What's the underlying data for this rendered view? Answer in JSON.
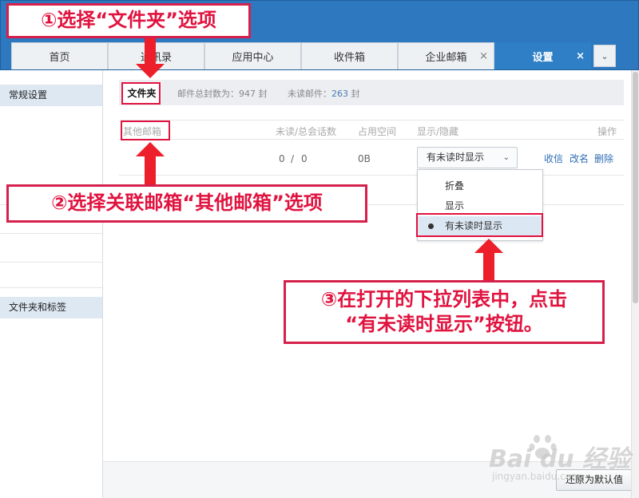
{
  "tabs": [
    {
      "label": "首页",
      "closable": false,
      "active": false
    },
    {
      "label": "通讯录",
      "closable": false,
      "active": false
    },
    {
      "label": "应用中心",
      "closable": false,
      "active": false
    },
    {
      "label": "收件箱",
      "closable": false,
      "active": false
    },
    {
      "label": "企业邮箱",
      "closable": true,
      "active": false
    },
    {
      "label": "设置",
      "closable": true,
      "active": true
    }
  ],
  "close_glyph": "×",
  "sidebar": {
    "items": [
      {
        "label": "常规设置"
      },
      {
        "label": "文件夹和标签"
      }
    ]
  },
  "infobar": {
    "folder_tab": "文件夹",
    "total_label": "邮件总封数为：",
    "total_value": "947",
    "total_unit": " 封",
    "unread_label": "未读邮件：",
    "unread_value": "263",
    "unread_unit": " 封"
  },
  "table": {
    "headers": {
      "name": "其他邮箱",
      "unread": "未读/总会话数",
      "space": "占用空间",
      "display": "显示/隐藏",
      "ops": "操作"
    },
    "row": {
      "unread": "0",
      "sep": "/",
      "total": "0",
      "space": "0B",
      "display_value": "有未读时显示",
      "ops": [
        "收信",
        "改名",
        "删除"
      ]
    }
  },
  "dropdown": {
    "options": [
      "折叠",
      "显示",
      "有未读时显示"
    ],
    "selected_index": 2
  },
  "footer": {
    "reset_button": "还原为默认值"
  },
  "annotations": {
    "step1": "①选择“文件夹”选项",
    "step2": "②选择关联邮箱“其他邮箱”选项",
    "step3_line1": "③在打开的下拉列表中，点击",
    "step3_line2": "“有未读时显示”按钮。"
  },
  "watermark": {
    "brand": "Bai du 经验",
    "site": "jingyan.baidu.com"
  },
  "colors": {
    "header_blue": "#2d78bf",
    "active_tab": "#2e7fc6",
    "annotation_red": "#e0133f",
    "arrow_red": "#ec1f2a",
    "link_blue": "#2e6db4"
  }
}
